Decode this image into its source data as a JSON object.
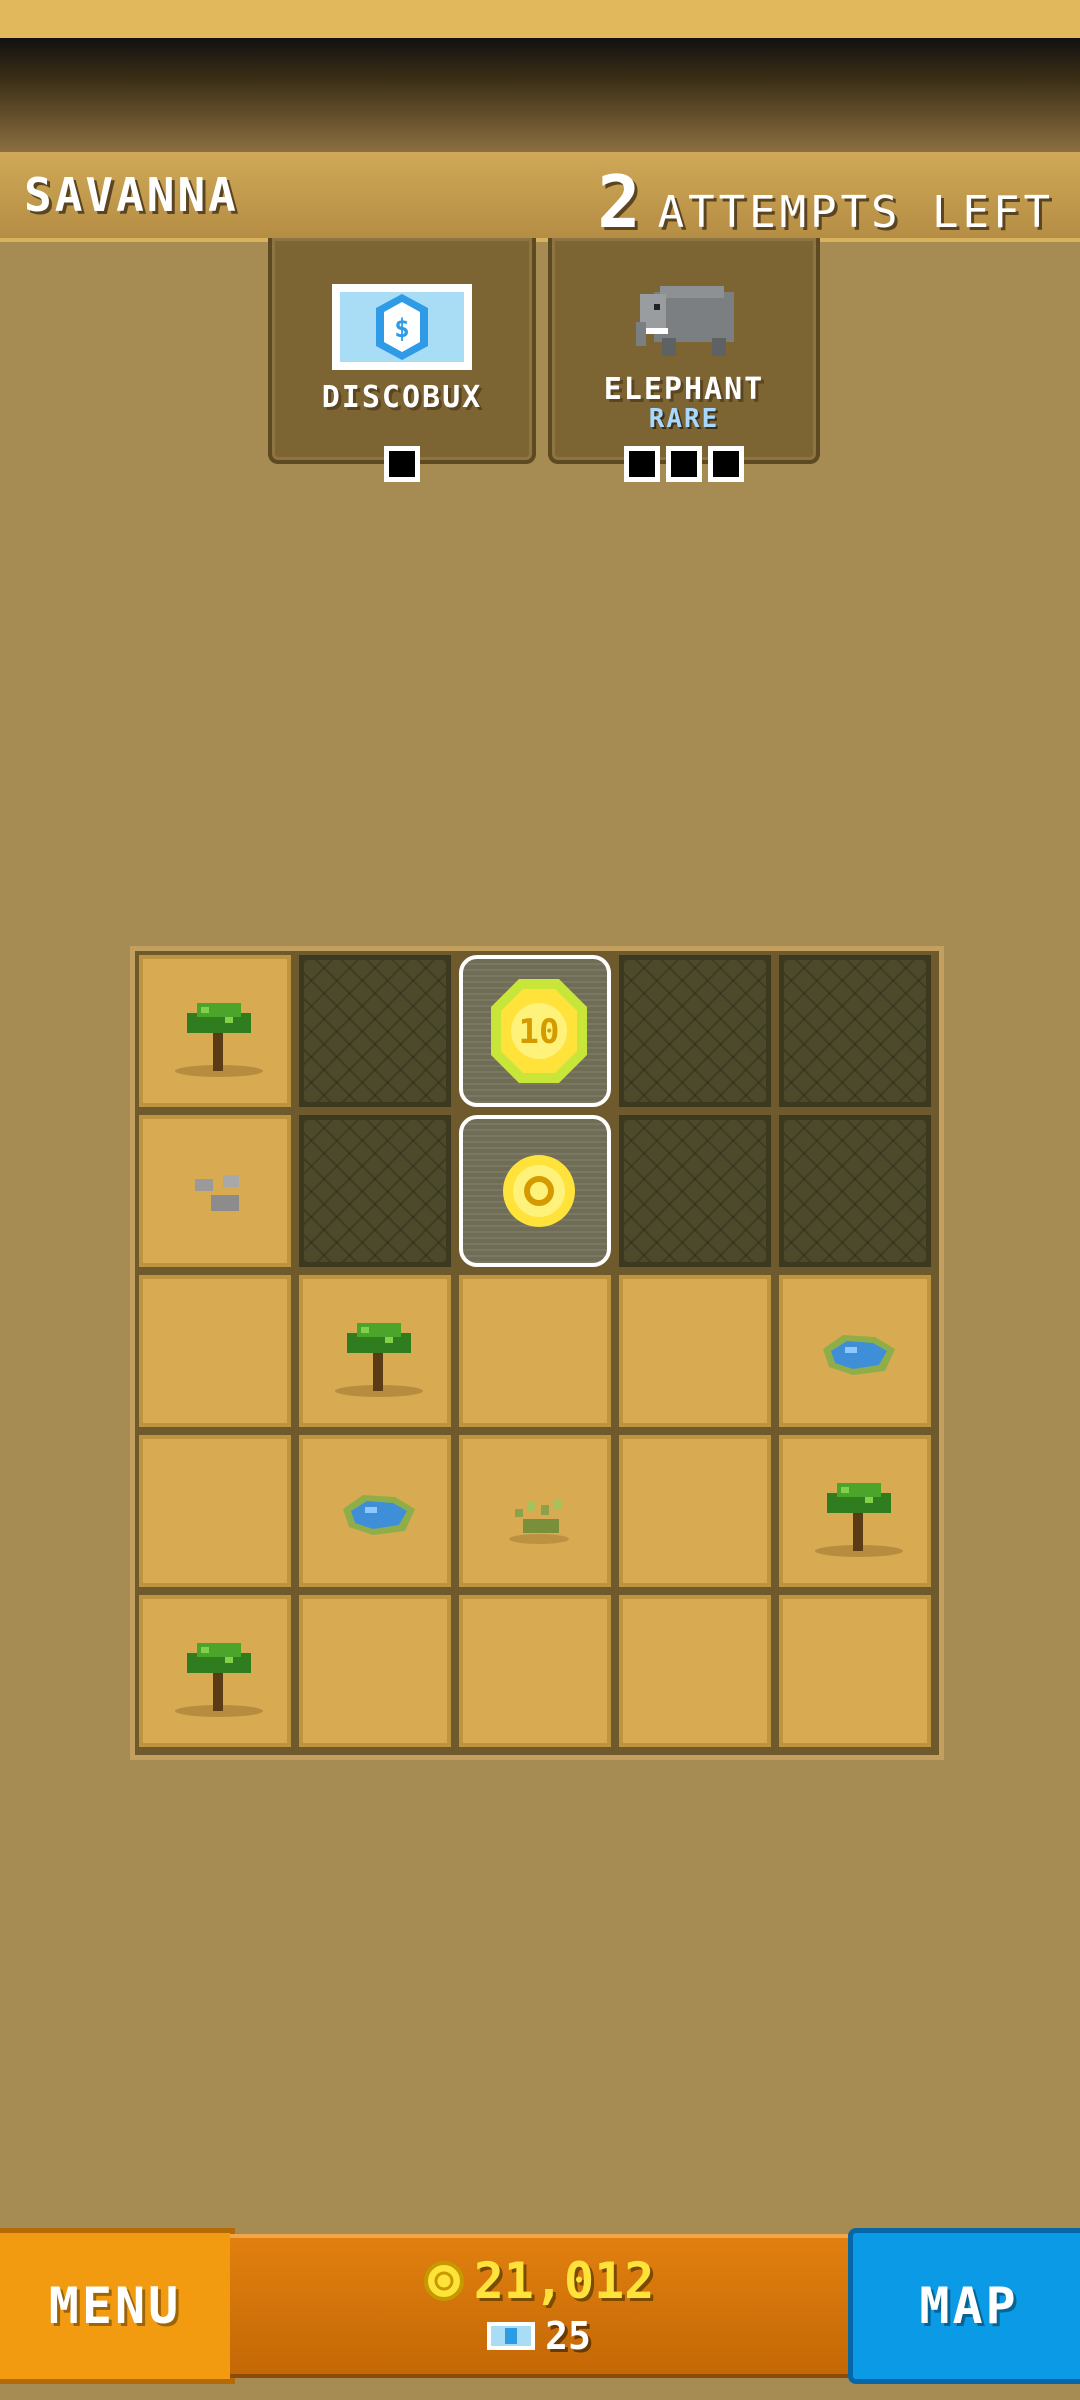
{
  "header": {
    "level_name": "SAVANNA",
    "attempts_count": "2",
    "attempts_label": "ATTEMPTS LEFT"
  },
  "targets": [
    {
      "label": "DISCOBUX",
      "label_color": "#a9d8ff",
      "icon": "discobux-bill-icon",
      "pips": 1
    },
    {
      "label": "ELEPHANT",
      "rarity": "RARE",
      "rarity_color": "#a9d8ff",
      "icon": "elephant-icon",
      "pips": 3
    }
  ],
  "board": {
    "rows": 5,
    "cols": 5,
    "cells": [
      [
        "tree",
        "dark",
        "coin-10",
        "dark",
        "dark"
      ],
      [
        "rocks",
        "dark",
        "coin",
        "dark",
        "dark"
      ],
      [
        "sand",
        "tree",
        "sand",
        "sand",
        "water"
      ],
      [
        "sand",
        "water",
        "bush",
        "sand",
        "tree"
      ],
      [
        "tree",
        "sand",
        "sand",
        "sand",
        "sand"
      ]
    ],
    "coin_10_label": "10"
  },
  "bottom_bar": {
    "menu_label": "MENU",
    "map_label": "MAP",
    "coins": "21,012",
    "gems": "25"
  },
  "colors": {
    "menu": "#f29b10",
    "map": "#0b9be6",
    "coin": "#ffe23a"
  }
}
